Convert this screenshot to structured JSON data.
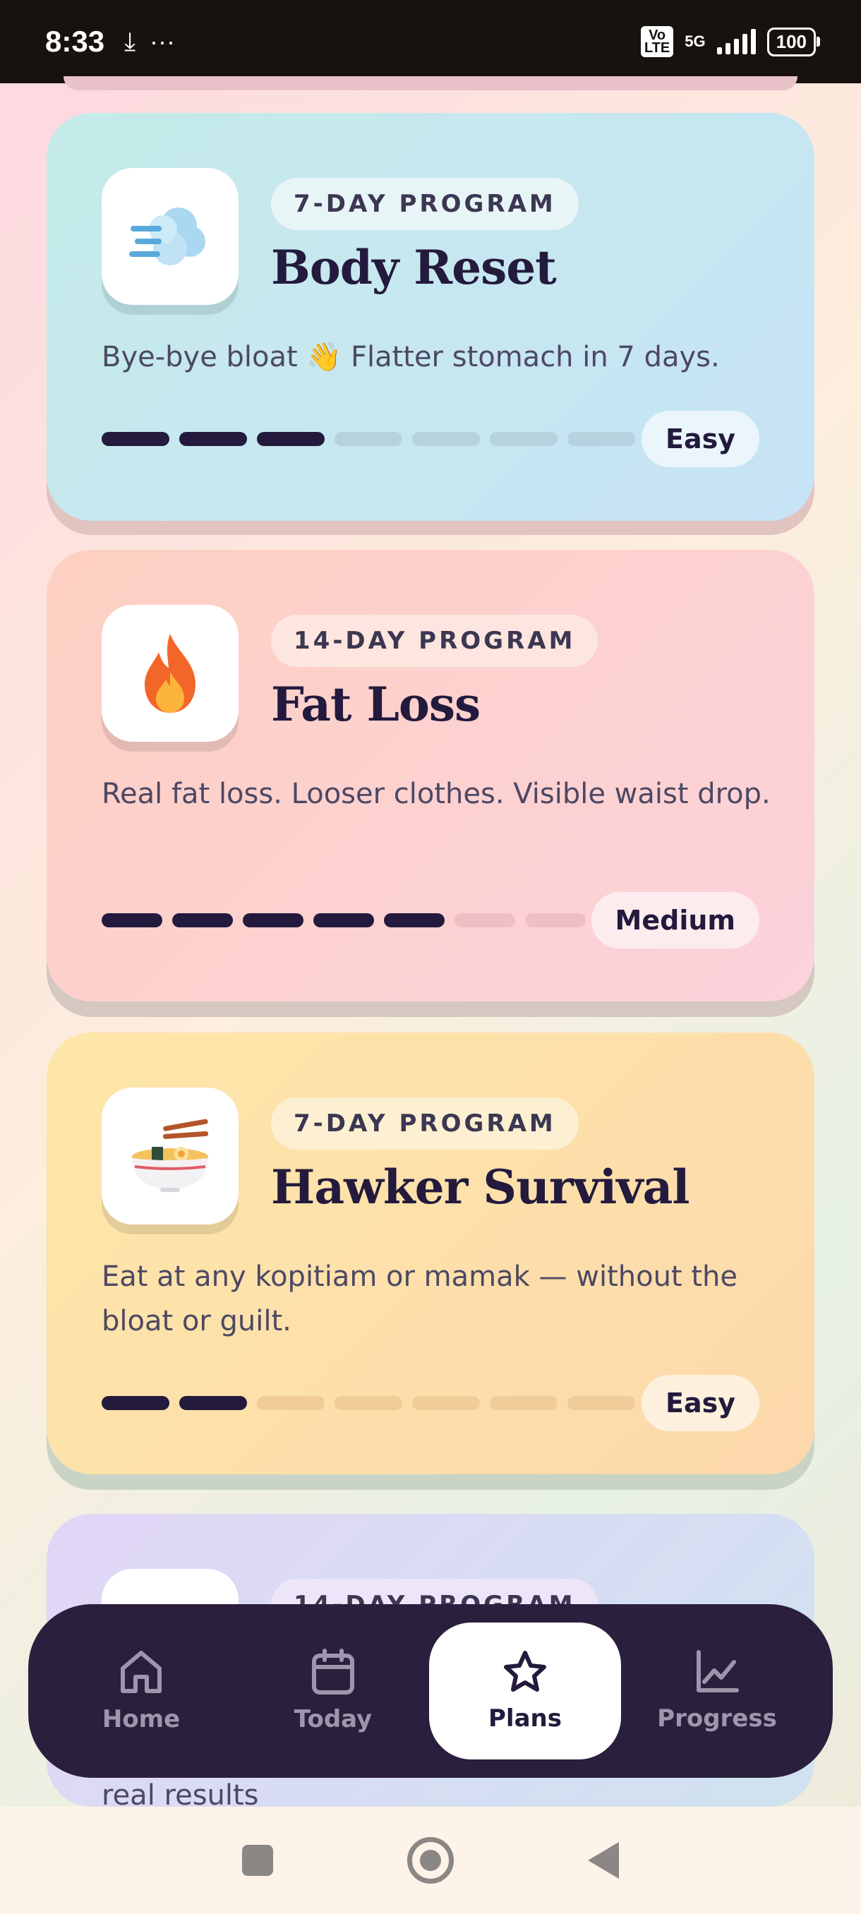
{
  "status_bar": {
    "time": "8:33",
    "download_glyph": "⤓",
    "more_glyph": "···",
    "volte": "Vo\nLTE",
    "network": "5G",
    "battery": "100"
  },
  "cards": [
    {
      "badge": "7-DAY PROGRAM",
      "title": "Body Reset",
      "description": "Bye-bye bloat 👋 Flatter stomach in 7 days.",
      "level": "Easy",
      "icon": "wind-face-icon",
      "emoji": "💨",
      "progress": {
        "filled": 3,
        "total": 7
      }
    },
    {
      "badge": "14-DAY PROGRAM",
      "title": "Fat Loss",
      "description": "Real fat loss. Looser clothes. Visible waist drop.",
      "level": "Medium",
      "icon": "fire-icon",
      "emoji": "🔥",
      "progress": {
        "filled": 5,
        "total": 7
      }
    },
    {
      "badge": "7-DAY PROGRAM",
      "title": "Hawker Survival",
      "description": "Eat at any kopitiam or mamak — without the bloat or guilt.",
      "level": "Easy",
      "icon": "noodle-bowl-icon",
      "emoji": "🍜",
      "progress": {
        "filled": 2,
        "total": 7
      }
    },
    {
      "badge": "14-DAY PROGRAM",
      "description_tail": "real results",
      "icon": "person-icon"
    }
  ],
  "nav": {
    "items": [
      {
        "label": "Home",
        "icon": "home-icon"
      },
      {
        "label": "Today",
        "icon": "calendar-icon"
      },
      {
        "label": "Plans",
        "icon": "star-icon",
        "active": true
      },
      {
        "label": "Progress",
        "icon": "chart-icon"
      }
    ]
  },
  "colors": {
    "card1": "#c6e8ef",
    "card2": "#fdd0cd",
    "card3": "#fde4b0",
    "card4": "#dcd5f0",
    "nav_bg": "#2a1f3d",
    "text_dark": "#231a3d"
  }
}
